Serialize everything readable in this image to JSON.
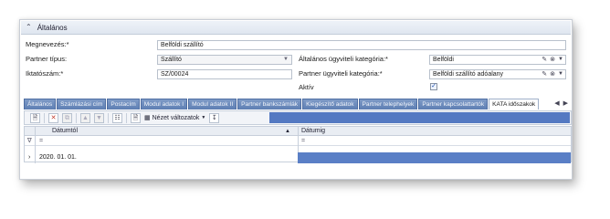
{
  "section": {
    "title": "Általános",
    "collapse_icon": "chevron-up-double-icon"
  },
  "form": {
    "name_label": "Megnevezés:*",
    "name_value": "Belföldi szállító",
    "partner_type_label": "Partner típus:",
    "partner_type_value": "Szállító",
    "general_category_label": "Általános ügyviteli kategória:*",
    "general_category_value": "Belföldi",
    "registry_label": "Iktatószám:*",
    "registry_value": "SZ/00024",
    "partner_category_label": "Partner ügyviteli kategória:*",
    "partner_category_value": "Belföldi szállító adóalany",
    "active_label": "Aktív",
    "active_checked": true
  },
  "tabs": [
    "Általános",
    "Számlázási cím",
    "Postacím",
    "Modul adatok I",
    "Modul adatok II",
    "Partner bankszámlák",
    "Kiegészítő adatok",
    "Partner telephelyek",
    "Partner kapcsolattartók",
    "KATA időszakok"
  ],
  "active_tab": "KATA időszakok",
  "toolbar": {
    "view_variants_label": "Nézet változatok"
  },
  "grid": {
    "columns": [
      "Dátumtól",
      "Dátumig"
    ],
    "filter_symbol": "=",
    "rows": [
      {
        "from": "2020. 01. 01.",
        "to": ""
      }
    ]
  },
  "colors": {
    "tab_blue": "#5d7eb3",
    "selection_blue": "#5a7fc6"
  }
}
